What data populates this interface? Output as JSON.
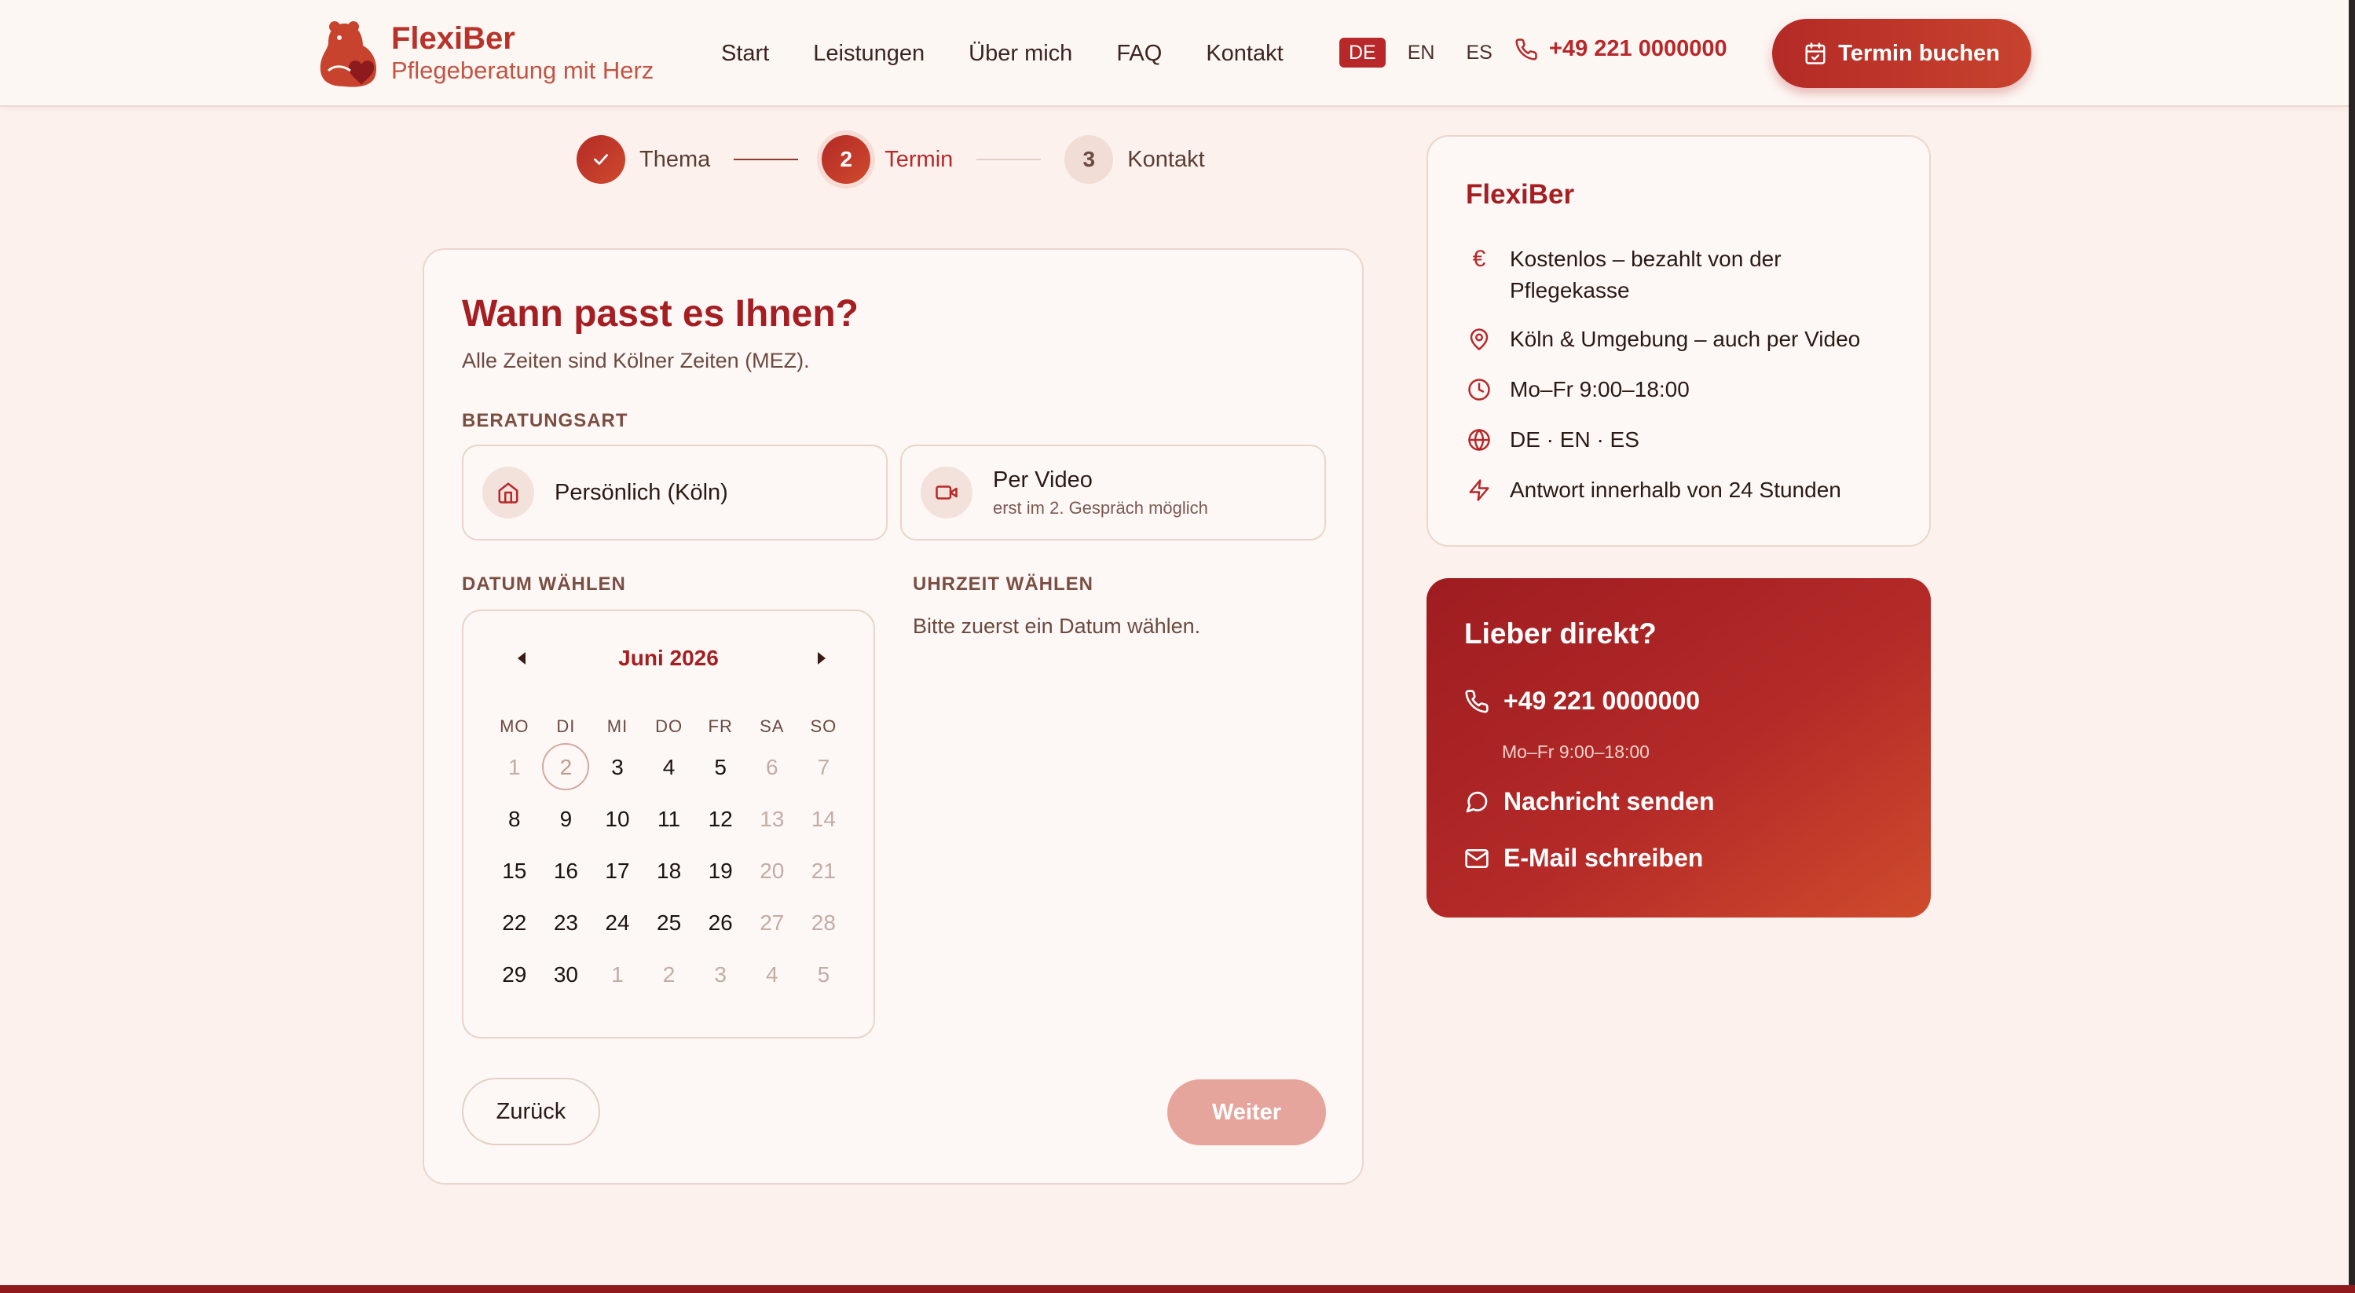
{
  "header": {
    "logo_name": "FlexiBer",
    "logo_tagline": "Pflegeberatung mit Herz",
    "nav": [
      "Start",
      "Leistungen",
      "Über mich",
      "FAQ",
      "Kontakt"
    ],
    "languages": [
      "DE",
      "EN",
      "ES"
    ],
    "active_language": "DE",
    "phone": "+49 221 0000000",
    "book_button": "Termin buchen"
  },
  "stepper": {
    "steps": [
      {
        "number": "",
        "label": "Thema",
        "state": "done"
      },
      {
        "number": "2",
        "label": "Termin",
        "state": "current"
      },
      {
        "number": "3",
        "label": "Kontakt",
        "state": "todo"
      }
    ]
  },
  "form": {
    "title": "Wann passt es Ihnen?",
    "subtitle": "Alle Zeiten sind Kölner Zeiten (MEZ).",
    "consult_type_label": "BERATUNGSART",
    "options": [
      {
        "title": "Persönlich (Köln)",
        "sub": "",
        "icon": "home-icon"
      },
      {
        "title": "Per Video",
        "sub": "erst im 2. Gespräch möglich",
        "icon": "video-icon"
      }
    ],
    "date_label": "DATUM WÄHLEN",
    "time_label": "UHRZEIT WÄHLEN",
    "time_hint": "Bitte zuerst ein Datum wählen.",
    "back_button": "Zurück",
    "next_button": "Weiter"
  },
  "calendar": {
    "month": "Juni 2026",
    "weekdays": [
      "MO",
      "DI",
      "MI",
      "DO",
      "FR",
      "SA",
      "SO"
    ],
    "weeks": [
      [
        {
          "d": "1",
          "m": true
        },
        {
          "d": "2",
          "today": true
        },
        {
          "d": "3"
        },
        {
          "d": "4"
        },
        {
          "d": "5"
        },
        {
          "d": "6",
          "m": true
        },
        {
          "d": "7",
          "m": true
        }
      ],
      [
        {
          "d": "8"
        },
        {
          "d": "9"
        },
        {
          "d": "10"
        },
        {
          "d": "11"
        },
        {
          "d": "12"
        },
        {
          "d": "13",
          "m": true
        },
        {
          "d": "14",
          "m": true
        }
      ],
      [
        {
          "d": "15"
        },
        {
          "d": "16"
        },
        {
          "d": "17"
        },
        {
          "d": "18"
        },
        {
          "d": "19"
        },
        {
          "d": "20",
          "m": true
        },
        {
          "d": "21",
          "m": true
        }
      ],
      [
        {
          "d": "22"
        },
        {
          "d": "23"
        },
        {
          "d": "24"
        },
        {
          "d": "25"
        },
        {
          "d": "26"
        },
        {
          "d": "27",
          "m": true
        },
        {
          "d": "28",
          "m": true
        }
      ],
      [
        {
          "d": "29"
        },
        {
          "d": "30"
        },
        {
          "d": "1",
          "m": true
        },
        {
          "d": "2",
          "m": true
        },
        {
          "d": "3",
          "m": true
        },
        {
          "d": "4",
          "m": true
        },
        {
          "d": "5",
          "m": true
        }
      ]
    ]
  },
  "info": {
    "title": "FlexiBer",
    "items": [
      {
        "icon": "euro-icon",
        "text": "Kostenlos – bezahlt von der Pflegekasse"
      },
      {
        "icon": "location-icon",
        "text": "Köln & Umgebung – auch per Video"
      },
      {
        "icon": "clock-icon",
        "text": "Mo–Fr 9:00–18:00"
      },
      {
        "icon": "globe-icon",
        "text": "DE · EN · ES"
      },
      {
        "icon": "lightning-icon",
        "text": "Antwort innerhalb von 24 Stunden"
      }
    ]
  },
  "direct": {
    "title": "Lieber direkt?",
    "phone": "+49 221 0000000",
    "hours": "Mo–Fr 9:00–18:00",
    "message": "Nachricht senden",
    "email": "E-Mail schreiben"
  },
  "colors": {
    "brand": "#b8282a",
    "brand_dark": "#a41e22",
    "background": "#fcf1ec",
    "next_disabled": "#e6a59c"
  }
}
